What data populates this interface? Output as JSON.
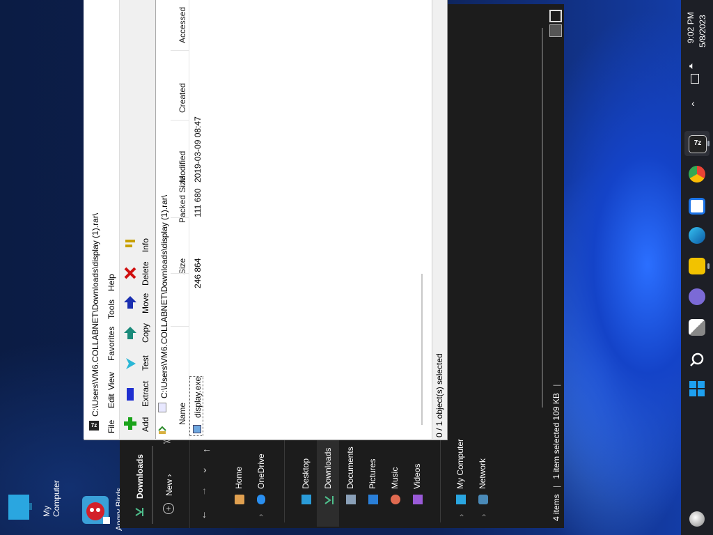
{
  "desktop": {
    "icons": [
      {
        "label_1": "My",
        "label_2": "Computer"
      },
      {
        "label_1": "Angry Birds"
      }
    ]
  },
  "zip": {
    "title": "C:\\Users\\VM6.COLLABNET\\Downloads\\display (1).rar\\",
    "menu": [
      "File",
      "Edit",
      "View",
      "Favorites",
      "Tools",
      "Help"
    ],
    "toolbar": [
      {
        "label": "Add",
        "icon": "add-icon",
        "color": "#1aa31a"
      },
      {
        "label": "Extract",
        "icon": "extract-icon",
        "color": "#1f2fd0"
      },
      {
        "label": "Test",
        "icon": "test-icon",
        "color": "#2bb7d6"
      },
      {
        "label": "Copy",
        "icon": "copy-icon",
        "color": "#1a8a7a"
      },
      {
        "label": "Move",
        "icon": "move-icon",
        "color": "#1a2fb0"
      },
      {
        "label": "Delete",
        "icon": "delete-icon",
        "color": "#d01010"
      },
      {
        "label": "Info",
        "icon": "info-icon",
        "color": "#c8a000"
      }
    ],
    "address": "C:\\Users\\VM6.COLLABNET\\Downloads\\display (1).rar\\",
    "columns": [
      "Name",
      "Size",
      "Packed Size",
      "Modified",
      "Created",
      "Accessed"
    ],
    "rows": [
      {
        "name": "display.exe",
        "size": "246 864",
        "packed": "111 680",
        "modified": "2019-03-09 08:47",
        "created": "",
        "accessed": ""
      }
    ],
    "status": "0 / 1 object(s) selected"
  },
  "explorer": {
    "current": "Downloads",
    "new_label": "New",
    "nav_home": [
      "Home",
      "OneDrive"
    ],
    "nav_pinned": [
      "Desktop",
      "Downloads",
      "Documents",
      "Pictures",
      "Music",
      "Videos"
    ],
    "nav_bottom": [
      "My Computer",
      "Network"
    ],
    "status": {
      "items": "4 items",
      "selected": "1 item selected  109 KB"
    }
  },
  "taskbar": {
    "time": "9:02 PM",
    "date": "5/8/2023",
    "apps": [
      "7zip-icon",
      "chrome-icon",
      "store-icon",
      "edge-icon",
      "file-explorer-icon",
      "teams-icon",
      "task-view-icon",
      "search-icon",
      "start-icon"
    ],
    "accent": "#0a66d8"
  }
}
